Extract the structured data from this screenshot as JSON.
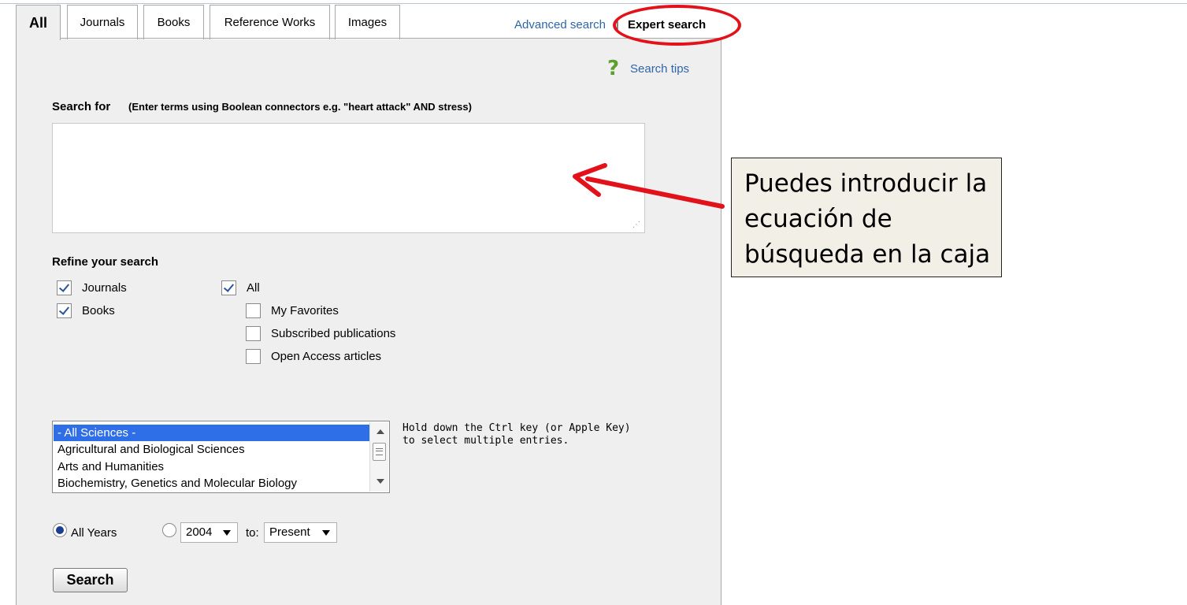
{
  "tabs": [
    {
      "label": "All",
      "active": true
    },
    {
      "label": "Journals",
      "active": false
    },
    {
      "label": "Books",
      "active": false
    },
    {
      "label": "Reference Works",
      "active": false
    },
    {
      "label": "Images",
      "active": false
    }
  ],
  "links": {
    "advanced": "Advanced search",
    "separator": "|",
    "expert": "Expert search",
    "search_tips": "Search tips"
  },
  "search": {
    "label": "Search for",
    "hint": "(Enter terms using Boolean connectors e.g. \"heart attack\" AND stress)",
    "value": ""
  },
  "refine": {
    "title": "Refine your search",
    "content_types": [
      {
        "label": "Journals",
        "checked": true
      },
      {
        "label": "Books",
        "checked": true
      }
    ],
    "access": [
      {
        "label": "All",
        "checked": true
      },
      {
        "label": "My Favorites",
        "checked": false
      },
      {
        "label": "Subscribed publications",
        "checked": false
      },
      {
        "label": "Open Access articles",
        "checked": false
      }
    ]
  },
  "subjects": {
    "items": [
      "- All Sciences -",
      "Agricultural and Biological Sciences",
      "Arts and Humanities",
      "Biochemistry, Genetics and Molecular Biology"
    ],
    "selected": "- All Sciences -",
    "hint_line1": "Hold down the Ctrl key (or Apple Key)",
    "hint_line2": "to select multiple entries."
  },
  "years": {
    "all_years_label": "All Years",
    "all_years_selected": true,
    "from_value": "2004",
    "to_label": "to:",
    "to_value": "Present"
  },
  "search_button": "Search",
  "annotation": {
    "line1": "Puedes introducir la",
    "line2": "ecuación de",
    "line3": "búsqueda en la caja",
    "highlight_color": "#e3121a"
  }
}
